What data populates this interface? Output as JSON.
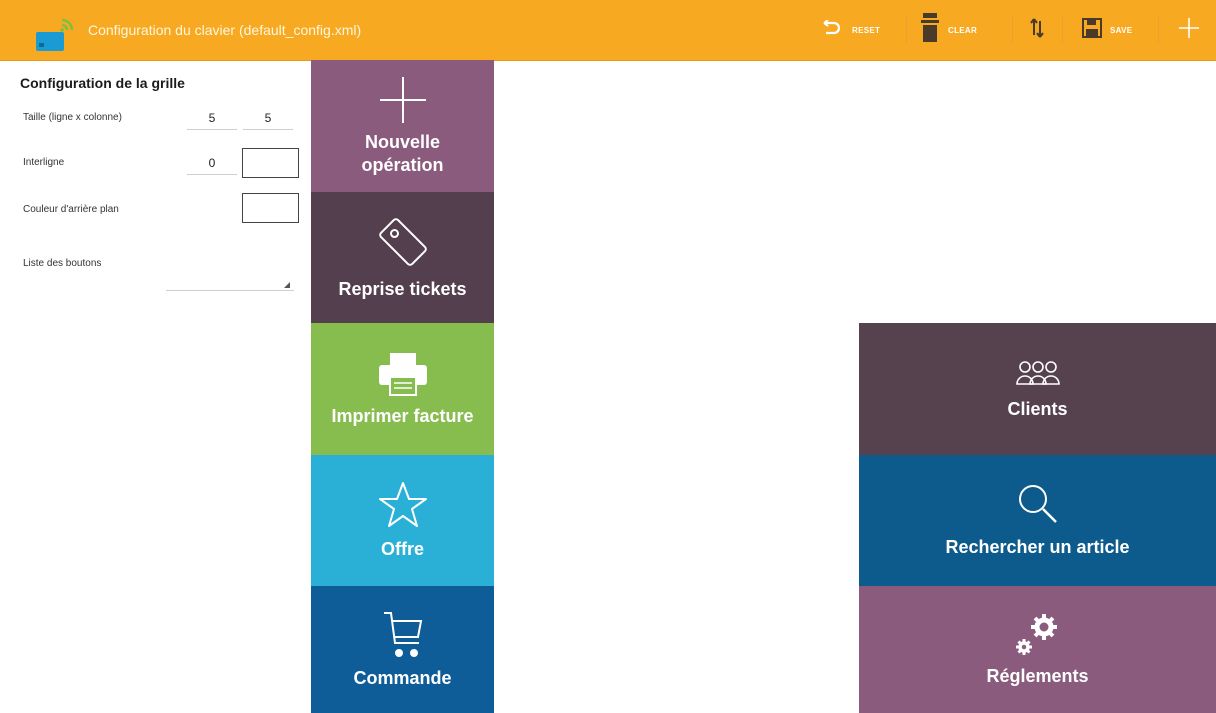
{
  "window": {
    "title": "Configuration du clavier (default_config.xml)"
  },
  "toolbar": {
    "reset_label": "RESET",
    "clear_label": "CLEAR",
    "save_label": "SAVE",
    "icons": [
      "undo-icon",
      "trash-icon",
      "sort-icon",
      "save-icon",
      "plus-icon"
    ]
  },
  "panel": {
    "title": "Configuration de la grille",
    "size": {
      "label": "Taille (ligne x colonne)",
      "rows": "5",
      "cols": "5"
    },
    "spacing": {
      "label": "Interligne",
      "value": "0"
    },
    "bg_color": {
      "label": "Couleur d'arrière plan"
    },
    "buttons_list": {
      "label": "Liste des boutons"
    }
  },
  "tiles": {
    "new_operation": {
      "label": "Nouvelle opération",
      "color": "#8a5b7c",
      "icon": "plus-icon"
    },
    "ticket_recovery": {
      "label": "Reprise tickets",
      "color": "#533f4d",
      "icon": "ticket-icon"
    },
    "print_invoice": {
      "label": "Imprimer facture",
      "color": "#86bd4e",
      "icon": "printer-icon"
    },
    "offer": {
      "label": "Offre",
      "color": "#2ab0d6",
      "icon": "star-icon"
    },
    "order": {
      "label": "Commande",
      "color": "#0e5d99",
      "icon": "cart-icon"
    },
    "clients": {
      "label": "Clients",
      "color": "#56424f",
      "icon": "users-icon"
    },
    "search_article": {
      "label": "Rechercher un article",
      "color": "#0d5b8c",
      "icon": "search-icon"
    },
    "payments": {
      "label": "Réglements",
      "color": "#8a5b7c",
      "icon": "gears-icon"
    }
  },
  "colors": {
    "topbar": "#f7a922",
    "topbar_text": "#fff7dc"
  }
}
